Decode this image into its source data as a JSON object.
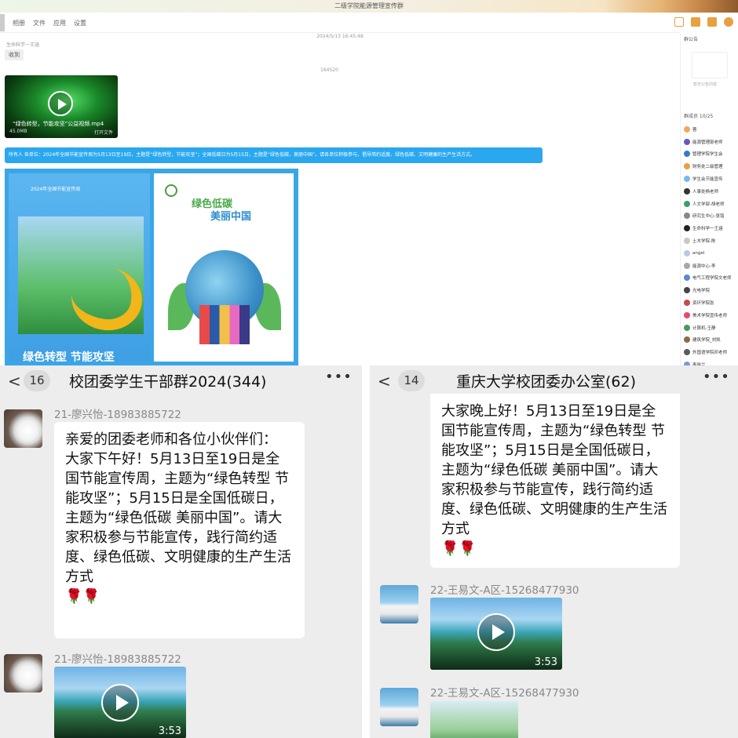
{
  "desktop": {
    "window_title": "二级学院能源管理宣传群",
    "nav_tabs": [
      "消息",
      "相册",
      "文件",
      "应用",
      "设置"
    ],
    "timestamp": "2024/5/13 16:45:48",
    "sender1": "生命科学一王涵",
    "bubble_small": "收到",
    "center_note": "164520",
    "video_name": "“绿色转型，节能攻坚”公益视频.mp4",
    "video_size": "45.0MB",
    "video_open": "打开文件",
    "notice": "所有人 各单位：2024年全国节能宣传周为5月13日至19日，主题是“绿色转型，节能攻坚”；全国低碳日为5月15日，主题是“绿色低碳，美丽中国”。请各单位积极参与，倡导简约适度、绿色低碳、文明健康的生产生活方式。",
    "poster1_title": "2024年全国节能宣传周",
    "poster1_slogan": "绿色转型 节能攻坚",
    "poster2_title_a": "绿色低碳",
    "poster2_title_b": "美丽中国",
    "members_header": "群公告",
    "members_qr_note": "暂无公告内容",
    "members_count": "群成员 10/25",
    "members": [
      {
        "name": "蓉",
        "color": "#f2a85a"
      },
      {
        "name": "能源管理部老师",
        "color": "#6a5ab8"
      },
      {
        "name": "管理学院学生会",
        "color": "#3a78c8"
      },
      {
        "name": "财务处二级管理",
        "color": "#e8a040"
      },
      {
        "name": "学生会节能宣传",
        "color": "#7ab8e8"
      },
      {
        "name": "人事处杨老师",
        "color": "#333333"
      },
      {
        "name": "人文学部-胡老师",
        "color": "#3aa06a"
      },
      {
        "name": "研究生中心-张铭",
        "color": "#888888"
      },
      {
        "name": "生命科学一王涵",
        "color": "#222222"
      },
      {
        "name": "土木学院-陈",
        "color": "#c8c8c8"
      },
      {
        "name": "angel",
        "color": "#b8c8e8"
      },
      {
        "name": "能源中心-李",
        "color": "#a8a8a8"
      },
      {
        "name": "电气工程学院文老师",
        "color": "#5a8ac8"
      },
      {
        "name": "光电学院",
        "color": "#444444"
      },
      {
        "name": "资环学院张",
        "color": "#c84a4a"
      },
      {
        "name": "美术学院宣传老师",
        "color": "#e84a6a"
      },
      {
        "name": "计算机-王静",
        "color": "#4a9a5a"
      },
      {
        "name": "建筑学院_刘凯",
        "color": "#8a6a4a"
      },
      {
        "name": "外国语学院邓老师",
        "color": "#5a5a5a"
      },
      {
        "name": "李晓兰",
        "color": "#7a9ad8"
      },
      {
        "name": "Icorpuo",
        "color": "#9ab8d8"
      },
      {
        "name": "现代物流学院-梁老师",
        "color": "#3a6aa8"
      }
    ]
  },
  "left_chat": {
    "back": "<",
    "badge": "16",
    "title": "校团委学生干部群2024(344)",
    "more": "•••",
    "sender": "21-廖兴怡-18983885722",
    "message": "亲爱的团委老师和各位小伙伴们：\n        大家下午好！5月13日至19日是全国节能宣传周，主题为“绿色转型 节能攻坚”；5月15日是全国低碳日，主题为“绿色低碳 美丽中国”。请大家积极参与节能宣传，践行简约适度、绿色低碳、文明健康的生产生活方式\n🌹🌹",
    "sender2": "21-廖兴怡-18983885722",
    "video_duration": "3:53"
  },
  "right_chat": {
    "back": "<",
    "badge": "14",
    "title": "重庆大学校团委办公室(62)",
    "more": "•••",
    "message": "        大家晚上好！5月13日至19日是全国节能宣传周，主题为“绿色转型 节能攻坚”；5月15日是全国低碳日，主题为“绿色低碳 美丽中国”。请大家积极参与节能宣传，践行简约适度、绿色低碳、文明健康的生产生活方式\n🌹🌹",
    "sender": "22-王易文-A区-15268477930",
    "video_duration": "3:53",
    "sender2": "22-王易文-A区-15268477930"
  }
}
